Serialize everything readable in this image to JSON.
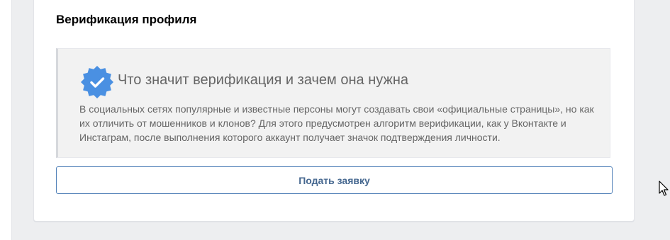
{
  "section": {
    "title": "Верификация профиля"
  },
  "info": {
    "heading": "Что значит верификация и зачем она нужна",
    "text": "В социальных сетях популярные и известные персоны могут создавать свои «официальные страницы», но как их отличить от мошенников и клонов? Для этого предусмотрен алгоритм верификации, как у Вконтакте и Инстаграм, после выполнения которого аккаунт получает значок подтверждения личности.",
    "icon": "verified-badge-icon",
    "badge_color": "#4a90e2"
  },
  "actions": {
    "submit_label": "Подать заявку"
  },
  "colors": {
    "accent": "#5181b8",
    "button_text": "#45678f",
    "background": "#edeef0"
  }
}
